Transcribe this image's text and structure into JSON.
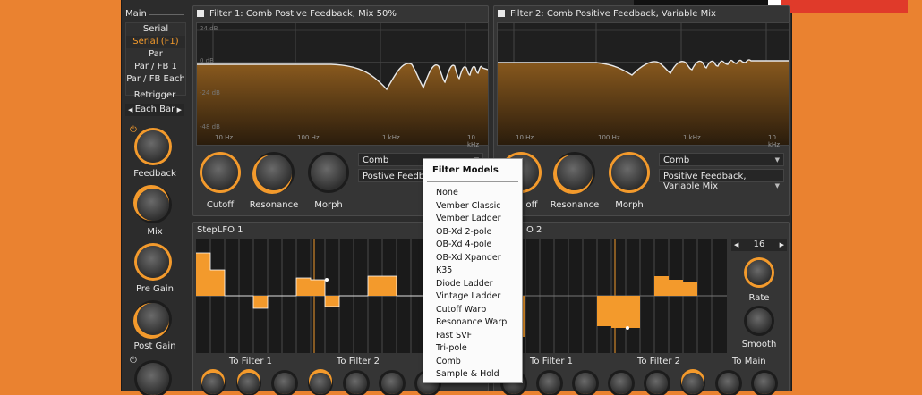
{
  "main": {
    "title": "Main",
    "modes": [
      "Serial",
      "Serial (F1)",
      "Par",
      "Par / FB 1",
      "Par / FB Each"
    ],
    "selected_mode": "Serial (F1)",
    "retrigger_label": "Retrigger",
    "retrigger_value": "Each Bar",
    "knobs": {
      "feedback": "Feedback",
      "mix": "Mix",
      "pre_gain": "Pre Gain",
      "post_gain": "Post Gain"
    }
  },
  "filter1": {
    "title": "Filter 1: Comb Postive Feedback, Mix 50%",
    "db_labels": [
      "24 dB",
      "0 dB",
      "-24 dB",
      "-48 dB"
    ],
    "freq_labels": [
      "10 Hz",
      "100 Hz",
      "1 kHz",
      "10 kHz"
    ],
    "model": "Comb",
    "submodel": "Postive Feedback",
    "knobs": {
      "cutoff": "Cutoff",
      "resonance": "Resonance",
      "morph": "Morph"
    }
  },
  "filter2": {
    "title": "Filter 2: Comb Positive Feedback, Variable Mix",
    "freq_labels": [
      "10 Hz",
      "100 Hz",
      "1 kHz",
      "10 kHz"
    ],
    "model": "Comb",
    "submodel": "Positive Feedback, Variable Mix",
    "knobs": {
      "cutoff": "off",
      "resonance": "Resonance",
      "morph": "Morph"
    }
  },
  "lfo1": {
    "title": "StepLFO 1",
    "targets": [
      "To Filter 1",
      "To Filter 2"
    ]
  },
  "lfo2": {
    "title": "O 2",
    "steps": "16",
    "rate": "Rate",
    "smooth": "Smooth",
    "targets": [
      "To Filter 1",
      "To Filter 2",
      "To Main"
    ]
  },
  "filter_models_menu": {
    "title": "Filter Models",
    "items": [
      "None",
      "Vember Classic",
      "Vember Ladder",
      "OB-Xd 2-pole",
      "OB-Xd 4-pole",
      "OB-Xd Xpander",
      "K35",
      "Diode Ladder",
      "Vintage Ladder",
      "Cutoff Warp",
      "Resonance Warp",
      "Fast SVF",
      "Tri-pole",
      "Comb",
      "Sample & Hold"
    ]
  },
  "colors": {
    "accent": "#f39a2c",
    "background": "#ea8230",
    "panel": "#353535"
  }
}
